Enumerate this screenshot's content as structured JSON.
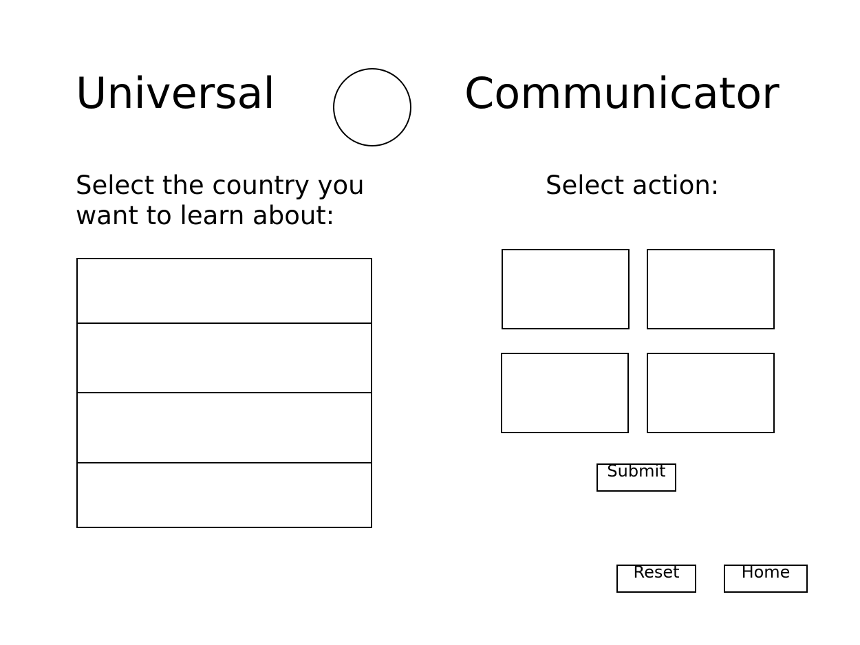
{
  "header": {
    "title_left": "Universal",
    "title_right": "Communicator",
    "logo": "circle-logo-icon"
  },
  "country_panel": {
    "prompt": "Select the country you want to learn about:",
    "items": [
      "",
      "",
      "",
      ""
    ]
  },
  "action_panel": {
    "prompt": "Select action:",
    "options": [
      "",
      "",
      "",
      ""
    ],
    "submit_label": "Submit"
  },
  "footer": {
    "reset_label": "Reset",
    "home_label": "Home"
  }
}
